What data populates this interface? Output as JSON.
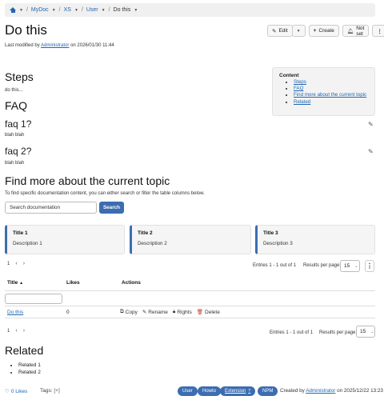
{
  "breadcrumb": {
    "items": [
      "MyDoc",
      "XS",
      "User"
    ],
    "current": "Do this"
  },
  "page": {
    "title": "Do this",
    "modified_prefix": "Last modified by",
    "modified_user": "Administrator",
    "modified_on": "on 2026/01/30 11:44"
  },
  "toolbar": {
    "edit_label": "Edit",
    "create_label": "Create",
    "notset_label": "Not set"
  },
  "sections": {
    "steps": "Steps",
    "steps_text": "do this...",
    "faq": "FAQ",
    "faq1": "faq 1?",
    "faq1_text": "blah blah",
    "faq2": "faq 2?",
    "faq2_text": "blah blah",
    "find": "Find more about the current topic",
    "find_text": "To find specific documentation content, you can either search or filter the table columns below.",
    "related": "Related"
  },
  "toc": {
    "title": "Content",
    "items": [
      "Steps",
      "FAQ",
      "Find more about the current topic",
      "Related"
    ]
  },
  "search": {
    "placeholder": "Search documentation",
    "button": "Search"
  },
  "cards": [
    {
      "title": "Title 1",
      "description": "Description 1"
    },
    {
      "title": "Title 2",
      "description": "Description 2"
    },
    {
      "title": "Title 3",
      "description": "Description 3"
    }
  ],
  "pagination": {
    "page": "1",
    "prev": "‹",
    "next": "›",
    "entries": "Entries 1 - 1 out of 1",
    "results_label": "Results per page:",
    "per_page": "15"
  },
  "table": {
    "headers": [
      "Title",
      "Likes",
      "Actions"
    ],
    "rows": [
      {
        "title": "Do this",
        "likes": "0",
        "copy": "Copy",
        "rename": "Rename",
        "rights": "Rights",
        "delete": "Delete"
      }
    ]
  },
  "related": [
    "Related 1",
    "Related 2"
  ],
  "footer": {
    "likes": "0 Likes",
    "tags_label": "Tags:",
    "tags_plus": "[+]",
    "tags": [
      "User",
      "Howto",
      "Extension",
      "NPM"
    ],
    "created_prefix": "Created by",
    "created_user": "Administrator",
    "created_on": "on 2025/12/22 13:23"
  },
  "colors": {
    "accent": "#3c6db0",
    "link": "#2067b0",
    "delete": "#c0392b"
  }
}
